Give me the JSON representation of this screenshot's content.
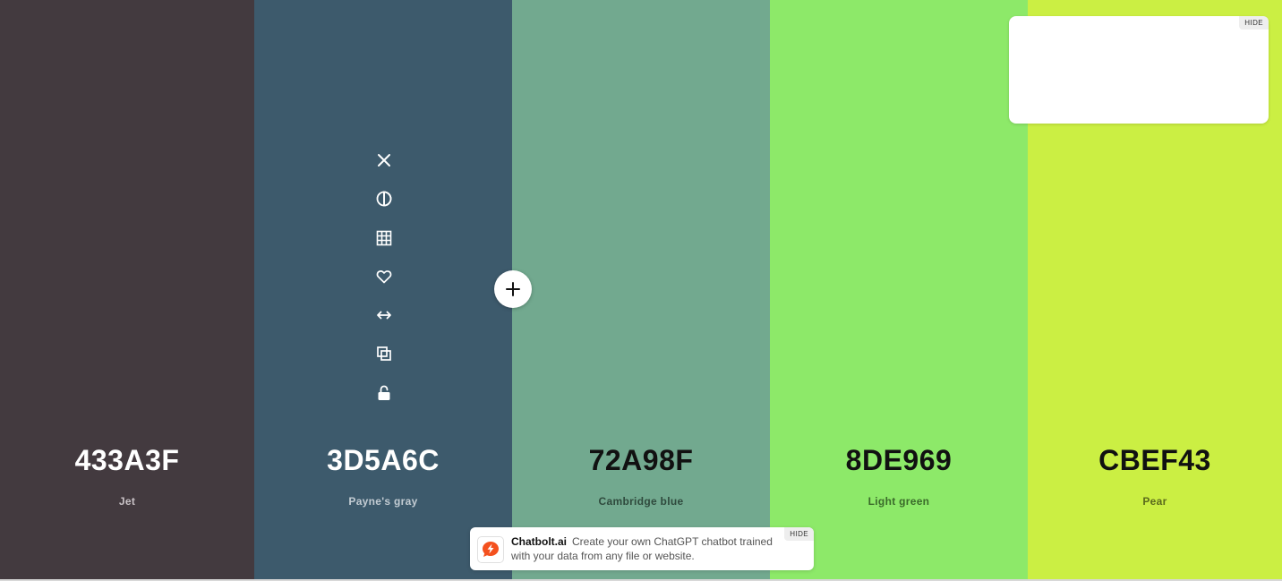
{
  "palette": {
    "colors": [
      {
        "hex": "433A3F",
        "name": "Jet",
        "bg": "#433A3F",
        "text_color": "#ffffff",
        "name_color": "#c9c2c6"
      },
      {
        "hex": "3D5A6C",
        "name": "Payne's gray",
        "bg": "#3D5A6C",
        "text_color": "#ffffff",
        "name_color": "#c3ccd3"
      },
      {
        "hex": "72A98F",
        "name": "Cambridge blue",
        "bg": "#72A98F",
        "text_color": "#111111",
        "name_color": "#2f4a3d"
      },
      {
        "hex": "8DE969",
        "name": "Light green",
        "bg": "#8DE969",
        "text_color": "#111111",
        "name_color": "#3a6a2a"
      },
      {
        "hex": "CBEF43",
        "name": "Pear",
        "bg": "#CBEF43",
        "text_color": "#111111",
        "name_color": "#5a6a1c"
      }
    ]
  },
  "toolbar": {
    "icons": [
      "close-icon",
      "contrast-icon",
      "grid-icon",
      "heart-icon",
      "drag-arrows-icon",
      "copy-icon",
      "unlock-icon"
    ],
    "icon_color": "#ffffff"
  },
  "add_button": {
    "icon": "plus-icon"
  },
  "ad_box": {
    "hide_label": "HIDE"
  },
  "promo": {
    "brand": "Chatbolt.ai",
    "text": "Create your own ChatGPT chatbot trained with your data from any file or website.",
    "hide_label": "HIDE",
    "logo_color": "#f4511e"
  }
}
